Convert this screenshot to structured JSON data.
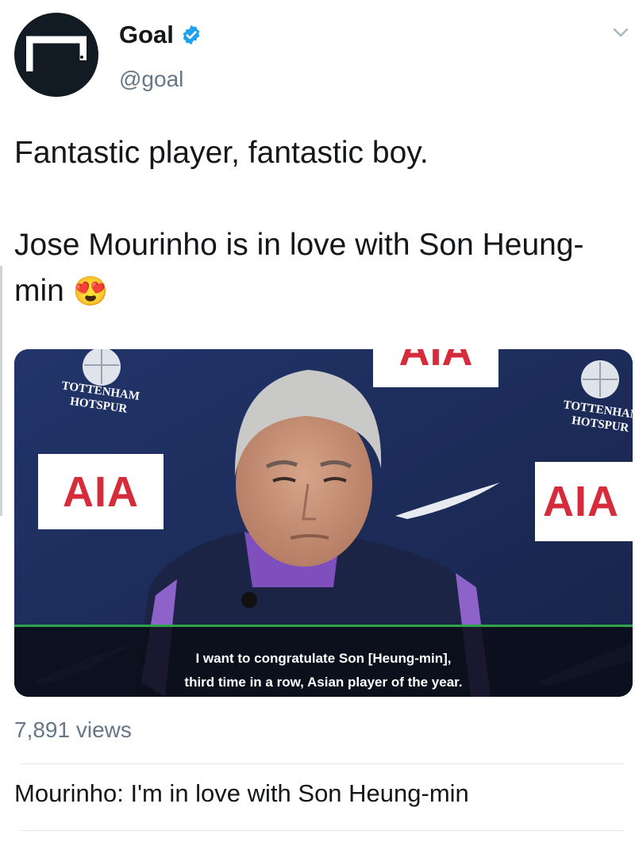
{
  "account": {
    "name": "Goal",
    "handle": "@goal",
    "verified": true,
    "avatar_icon": "goal-logo-icon",
    "colors": {
      "avatar_bg": "#121a23",
      "verified": "#1da1f2"
    }
  },
  "tweet": {
    "line1": "Fantastic player, fantastic boy.",
    "line2": "Jose Mourinho is in love with Son Heung-min",
    "emoji": "😍"
  },
  "video": {
    "sponsor": "AIA",
    "club_line1": "TOTTENHAM",
    "club_line2": "HOTSPUR",
    "subtitle_line1": "I want to congratulate Son [Heung-min],",
    "subtitle_line2": "third time in a row, Asian player of the year."
  },
  "stats": {
    "views": "7,891 views"
  },
  "card": {
    "title": "Mourinho: I'm in love with Son Heung-min"
  }
}
